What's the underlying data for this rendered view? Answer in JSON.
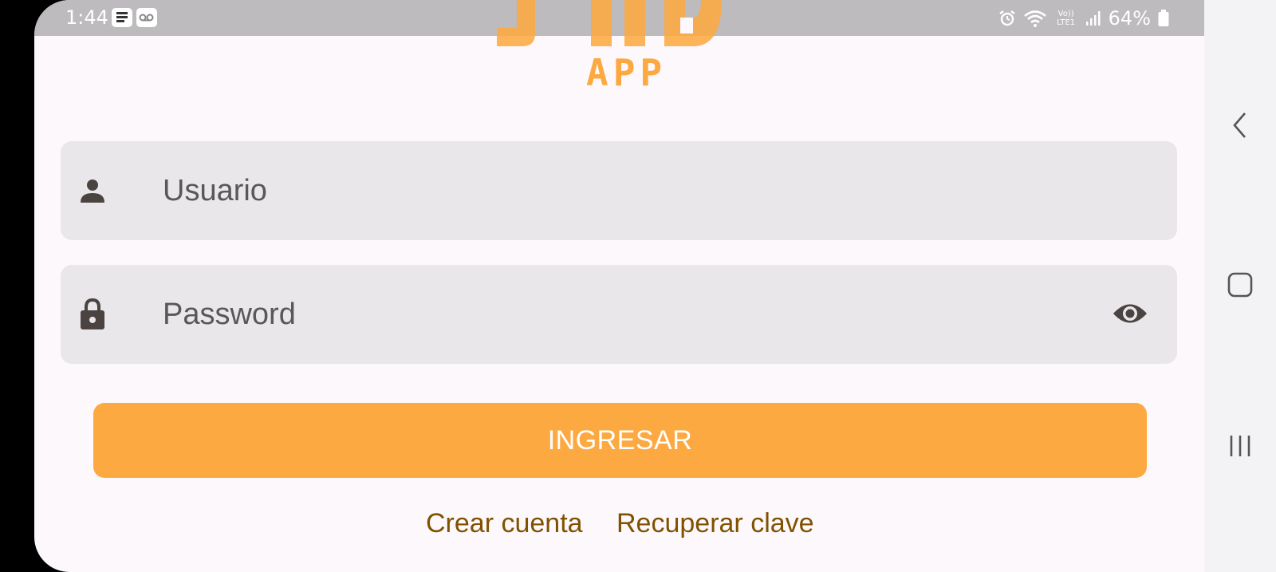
{
  "status_bar": {
    "time": "1:44",
    "battery": "64%",
    "network_label": "Vo)) LTE1"
  },
  "logo": {
    "text": "APP",
    "color": "#fda941"
  },
  "login": {
    "username_placeholder": "Usuario",
    "password_placeholder": "Password",
    "submit_label": "INGRESAR",
    "create_account_label": "Crear cuenta",
    "recover_password_label": "Recuperar clave"
  },
  "colors": {
    "accent": "#fda941",
    "link": "#805200",
    "field_bg": "#e9e7ea",
    "icon": "#4a4340"
  },
  "icons": {
    "username": "person-icon",
    "password": "lock-icon",
    "toggle_visibility": "eye-icon",
    "nav_back": "back-icon",
    "nav_home": "home-icon",
    "nav_recents": "recents-icon"
  }
}
